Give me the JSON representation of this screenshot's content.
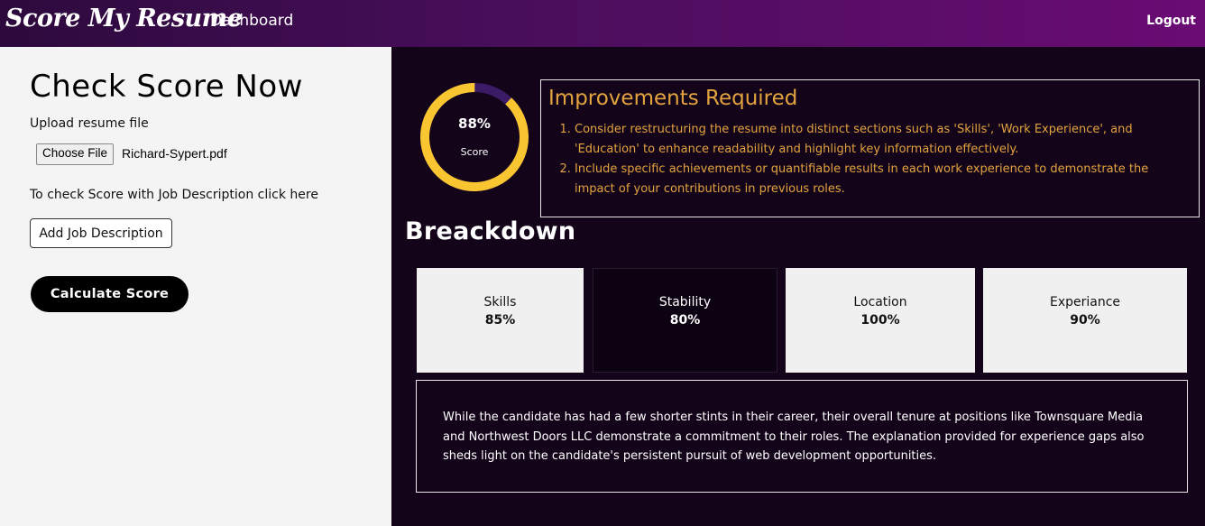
{
  "header": {
    "brand": "Score My Resume",
    "dashboard_label": "Dashboard",
    "logout_label": "Logout"
  },
  "left": {
    "title": "Check Score Now",
    "upload_label": "Upload resume file",
    "choose_file_label": "Choose File",
    "file_name": "Richard-Sypert.pdf",
    "jd_text": "To check Score with Job Description click here",
    "add_jd_label": "Add Job Description",
    "calculate_label": "Calculate Score"
  },
  "score": {
    "value": 88,
    "value_text": "88%",
    "label": "Score",
    "colors": {
      "fill": "#f9c531",
      "track": "#3b1a66"
    }
  },
  "improvements": {
    "title": "Improvements Required",
    "items": [
      "Consider restructuring the resume into distinct sections such as 'Skills', 'Work Experience', and 'Education' to enhance readability and highlight key information effectively.",
      "Include specific achievements or quantifiable results in each work experience to demonstrate the impact of your contributions in previous roles."
    ]
  },
  "breakdown": {
    "title": "Breackdown",
    "cards": [
      {
        "label": "Skills",
        "value": "85%"
      },
      {
        "label": "Stability",
        "value": "80%"
      },
      {
        "label": "Location",
        "value": "100%"
      },
      {
        "label": "Experiance",
        "value": "90%"
      }
    ],
    "summary": "While the candidate has had a few shorter stints in their career, their overall tenure at positions like Townsquare Media and Northwest Doors LLC demonstrate a commitment to their roles. The explanation provided for experience gaps also sheds light on the candidate's persistent pursuit of web development opportunities."
  },
  "colors": {
    "header_gradient_start": "#2c0a3d",
    "header_gradient_end": "#6a0c74",
    "accent_orange": "#e3a33e",
    "dark_bg": "#13041a"
  }
}
